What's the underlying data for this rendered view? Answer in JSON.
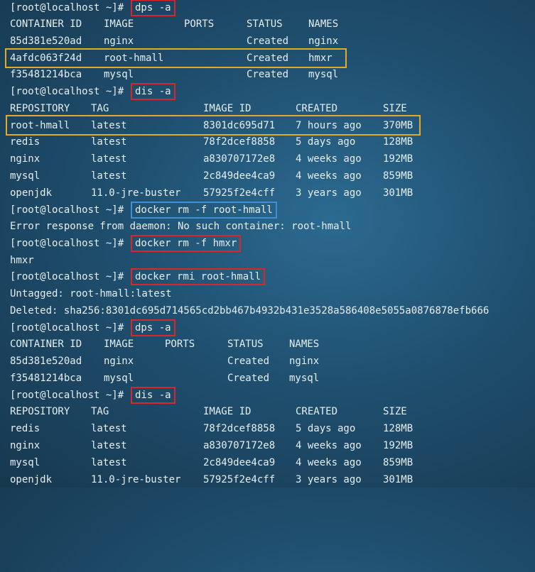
{
  "prompt": "[root@localhost ~]#",
  "commands": {
    "c1": "dps -a",
    "c2": "dis -a",
    "c3": "docker rm -f root-hmall",
    "c4": "docker rm -f hmxr",
    "c5": "docker rmi root-hmall",
    "c6": "dps -a",
    "c7": "dis -a"
  },
  "containers_header": [
    "CONTAINER ID",
    "IMAGE",
    "PORTS",
    "STATUS",
    "NAMES"
  ],
  "containers_before": [
    [
      "85d381e520ad",
      "nginx",
      "",
      "Created",
      "nginx"
    ],
    [
      "4afdc063f24d",
      "root-hmall",
      "",
      "Created",
      "hmxr"
    ],
    [
      "f35481214bca",
      "mysql",
      "",
      "Created",
      "mysql"
    ]
  ],
  "images_header": [
    "REPOSITORY",
    "TAG",
    "IMAGE ID",
    "CREATED",
    "SIZE"
  ],
  "images_before": [
    [
      "root-hmall",
      "latest",
      "8301dc695d71",
      "7 hours ago",
      "370MB"
    ],
    [
      "redis",
      "latest",
      "78f2dcef8858",
      "5 days ago",
      "128MB"
    ],
    [
      "nginx",
      "latest",
      "a830707172e8",
      "4 weeks ago",
      "192MB"
    ],
    [
      "mysql",
      "latest",
      "2c849dee4ca9",
      "4 weeks ago",
      "859MB"
    ],
    [
      "openjdk",
      "11.0-jre-buster",
      "57925f2e4cff",
      "3 years ago",
      "301MB"
    ]
  ],
  "output": {
    "rm_error": "Error response from daemon: No such container: root-hmall",
    "rm_ok": "hmxr",
    "untagged": "Untagged: root-hmall:latest",
    "deleted": "Deleted: sha256:8301dc695d714565cd2bb467b4932b431e3528a586408e5055a0876878efb666"
  },
  "containers_after": [
    [
      "85d381e520ad",
      "nginx",
      "",
      "Created",
      "nginx"
    ],
    [
      "f35481214bca",
      "mysql",
      "",
      "Created",
      "mysql"
    ]
  ],
  "images_after": [
    [
      "redis",
      "latest",
      "78f2dcef8858",
      "5 days ago",
      "128MB"
    ],
    [
      "nginx",
      "latest",
      "a830707172e8",
      "4 weeks ago",
      "192MB"
    ],
    [
      "mysql",
      "latest",
      "2c849dee4ca9",
      "4 weeks ago",
      "859MB"
    ],
    [
      "openjdk",
      "11.0-jre-buster",
      "57925f2e4cff",
      "3 years ago",
      "301MB"
    ]
  ],
  "colors": {
    "background": "#1f4f6f",
    "text": "#e6eef2",
    "command_box": "#d8262a",
    "failed_command_box": "#3d8fd6",
    "row_highlight": "#e4a928"
  }
}
